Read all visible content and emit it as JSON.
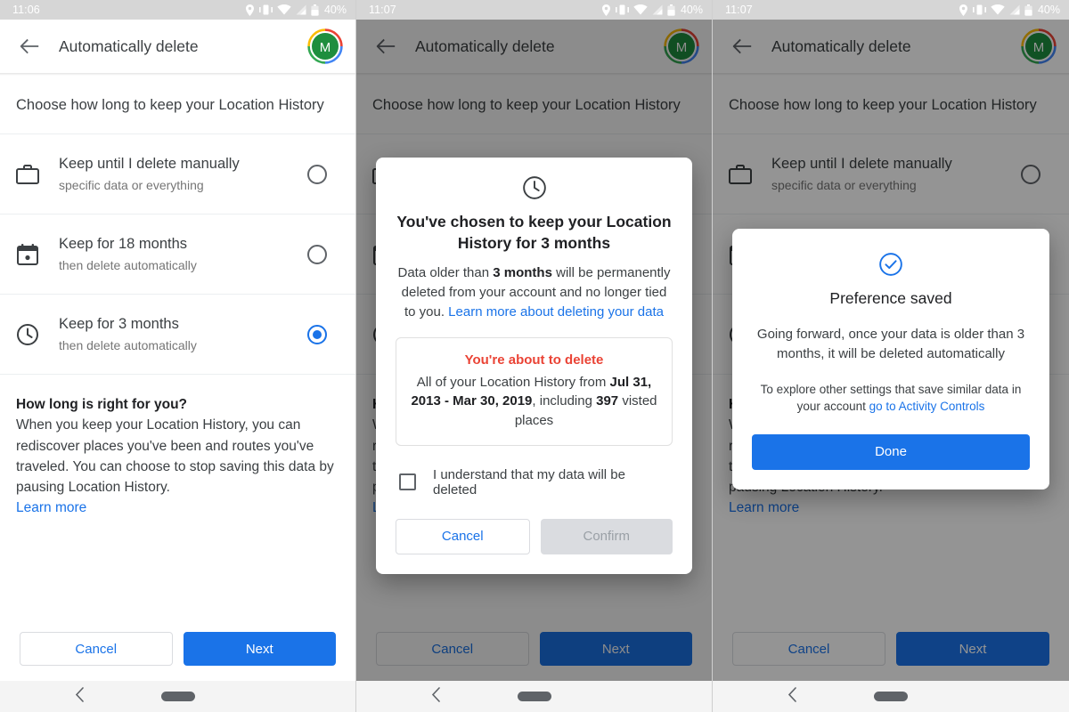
{
  "panels": [
    {
      "status": {
        "time": "11:06",
        "battery": "40%",
        "icons": [
          "location-pin-icon",
          "vibrate-icon",
          "wifi-icon",
          "signal-icon",
          "battery-icon"
        ]
      },
      "appbar": {
        "title": "Automatically delete",
        "back_icon": "back-arrow-icon",
        "avatar_letter": "M"
      }
    },
    {
      "status": {
        "time": "11:07",
        "battery": "40%",
        "icons": [
          "location-pin-icon",
          "vibrate-icon",
          "wifi-icon",
          "signal-icon",
          "battery-icon"
        ]
      },
      "appbar": {
        "title": "Automatically delete",
        "back_icon": "back-arrow-icon",
        "avatar_letter": "M"
      }
    },
    {
      "status": {
        "time": "11:07",
        "battery": "40%",
        "icons": [
          "location-pin-icon",
          "vibrate-icon",
          "wifi-icon",
          "signal-icon",
          "battery-icon"
        ]
      },
      "appbar": {
        "title": "Automatically delete",
        "back_icon": "back-arrow-icon",
        "avatar_letter": "M"
      }
    }
  ],
  "page": {
    "subhead": "Choose how long to keep your Location History",
    "options": [
      {
        "icon": "briefcase-icon",
        "title": "Keep until I delete manually",
        "subtitle": "specific data or everything",
        "selected": false
      },
      {
        "icon": "calendar-icon",
        "title": "Keep for 18 months",
        "subtitle": "then delete automatically",
        "selected": false
      },
      {
        "icon": "clock-icon",
        "title": "Keep for 3 months",
        "subtitle": "then delete automatically",
        "selected": true
      }
    ],
    "info": {
      "heading": "How long is right for you?",
      "body": "When you keep your Location History, you can rediscover places you've been and routes you've traveled. You can choose to stop saving this data by pausing Location History.",
      "link": "Learn more"
    },
    "actions": {
      "cancel": "Cancel",
      "next": "Next"
    }
  },
  "confirm_dialog": {
    "icon": "clock-icon",
    "title": "You've chosen to keep your Location History for 3 months",
    "body_part1": "Data older than ",
    "body_bold": "3 months",
    "body_part2": " will be permanently deleted from your account and no longer tied to you. ",
    "body_link": "Learn more about deleting your data",
    "warning": {
      "heading": "You're about to delete",
      "text_part1": "All of your Location History from ",
      "range_bold": "Jul 31, 2013 - Mar 30, 2019",
      "text_part2": ", including ",
      "count_bold": "397",
      "text_part3": " visted places"
    },
    "checkbox_label": "I understand that my data will be deleted",
    "cancel": "Cancel",
    "confirm": "Confirm",
    "confirm_enabled": false,
    "checked": false
  },
  "saved_dialog": {
    "icon": "check-circle-icon",
    "title": "Preference saved",
    "body": "Going forward, once your data is older than 3 months, it will be deleted automatically",
    "note_part1": "To explore other settings that save similar data in your account ",
    "note_link": "go to Activity Controls",
    "done": "Done"
  },
  "navbar": {
    "back_icon": "nav-back-icon",
    "home_pill": "home-pill-icon"
  },
  "colors": {
    "accent_blue": "#1a73e8",
    "warning_red": "#ea4335",
    "avatar_green": "#1e8e3e",
    "statusbar_gray": "#d6d6d6",
    "scrim": "rgba(0,0,0,0.45)"
  }
}
